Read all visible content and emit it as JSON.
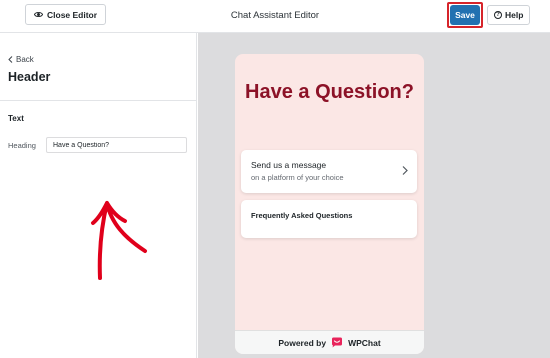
{
  "topbar": {
    "close_label": "Close Editor",
    "title": "Chat Assistant Editor",
    "save_label": "Save",
    "help_label": "Help",
    "help_icon_glyph": "?"
  },
  "left_panel": {
    "back_label": "Back",
    "title": "Header",
    "section_label": "Text",
    "heading_label": "Heading",
    "heading_value": "Have a Question?"
  },
  "preview": {
    "heading": "Have a Question?",
    "cards": [
      {
        "title": "Send us a message",
        "subtitle": "on a platform of your choice"
      },
      {
        "title": "Frequently Asked Questions"
      }
    ],
    "footer_powered": "Powered by",
    "footer_brand": "WPChat"
  },
  "colors": {
    "save_button": "#2271b1",
    "save_highlight": "#d6242a",
    "annotation_arrow": "#e0001b",
    "heading_text": "#8c1227",
    "phone_background": "#fbe7e5",
    "brand_logo": "#e8245b"
  },
  "icons": {
    "close": "eye-icon",
    "help": "question-circle-icon",
    "back": "chevron-left-icon",
    "card_arrow": "chevron-right-icon",
    "brand": "wpchat-logo-icon"
  }
}
